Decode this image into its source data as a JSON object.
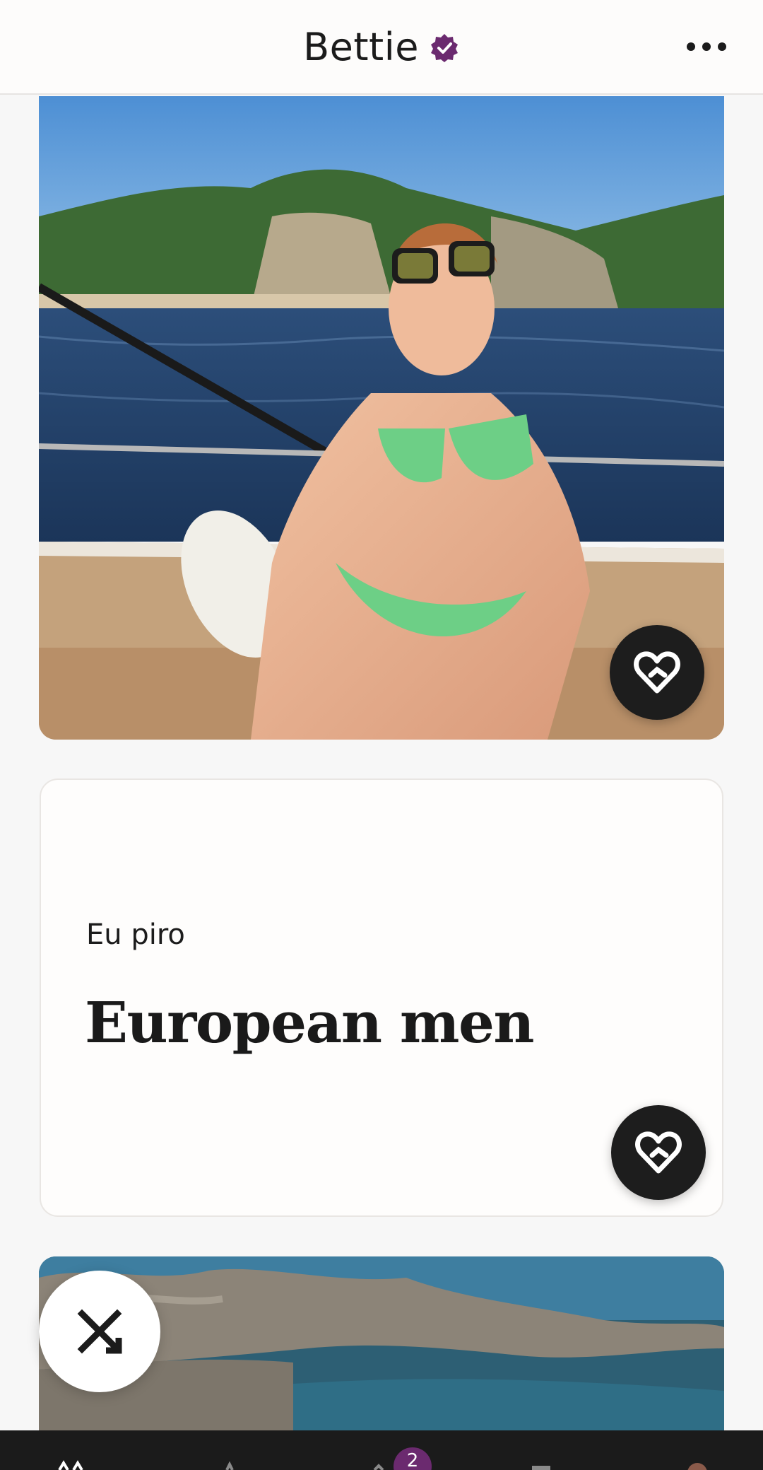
{
  "header": {
    "name": "Bettie",
    "verified_icon": "verified-badge-icon",
    "more_icon": "more-horizontal-icon"
  },
  "photo_cards": [
    {
      "id": "photo-1",
      "description_icon": "photo",
      "action_icon": "heart-icon"
    },
    {
      "id": "photo-2",
      "description_icon": "photo"
    }
  ],
  "prompt": {
    "question": "Eu piro",
    "answer": "European men",
    "action_icon": "heart-icon"
  },
  "skip": {
    "icon": "close-icon"
  },
  "bottom_nav": {
    "items": [
      "home-icon",
      "standouts-icon",
      "likes-icon",
      "matches-icon",
      "profile-icon"
    ],
    "likes_badge": "2"
  },
  "colors": {
    "accent": "#6b2a6f",
    "button_dark": "#1d1d1d",
    "background": "#f7f7f7"
  }
}
